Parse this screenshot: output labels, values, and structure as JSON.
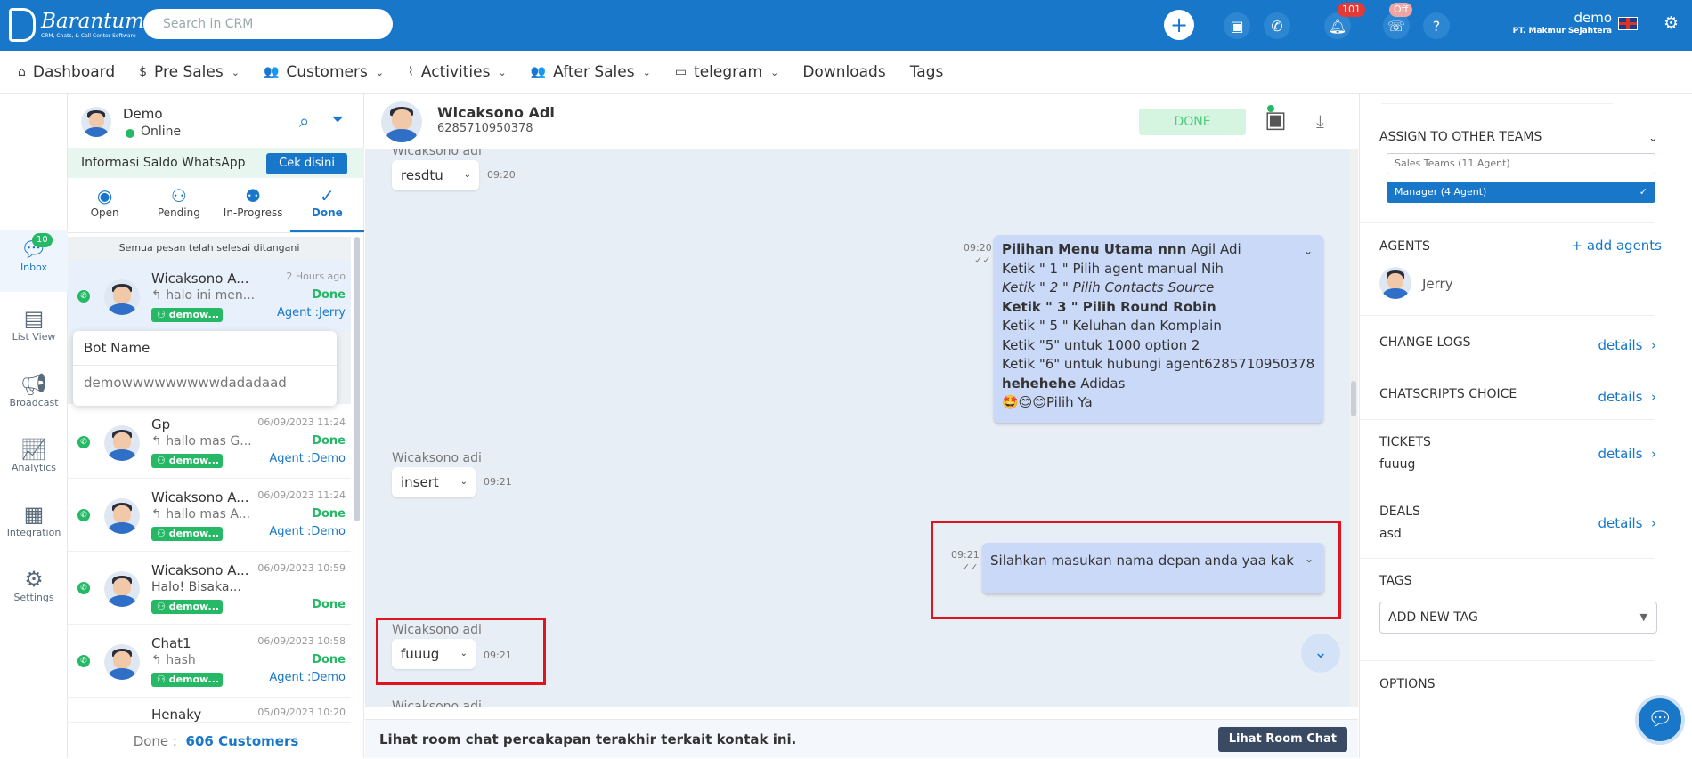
{
  "app": {
    "logo_name": "Barantum",
    "logo_tagline": "CRM, Chats, & Call Center Software",
    "search_placeholder": "Search in CRM",
    "notif_count": "101",
    "phone_status": "Off",
    "user_name": "demo",
    "company": "PT. Makmur Sejahtera"
  },
  "nav": {
    "items": [
      {
        "label": "Dashboard",
        "icon": "⌂",
        "dropdown": ""
      },
      {
        "label": "Pre Sales",
        "icon": "$",
        "dropdown": "⌄"
      },
      {
        "label": "Customers",
        "icon": "👥",
        "dropdown": "⌄"
      },
      {
        "label": "Activities",
        "icon": "⌇",
        "dropdown": "⌄"
      },
      {
        "label": "After Sales",
        "icon": "👥",
        "dropdown": "⌄"
      },
      {
        "label": "telegram",
        "icon": "▭",
        "dropdown": "⌄"
      },
      {
        "label": "Downloads",
        "icon": "",
        "dropdown": ""
      },
      {
        "label": "Tags",
        "icon": "",
        "dropdown": ""
      }
    ]
  },
  "rail": {
    "inbox_badge": "10",
    "items": [
      "Inbox",
      "List View",
      "Broadcast",
      "Analytics",
      "Integration",
      "Settings"
    ]
  },
  "chatlist": {
    "agent_name": "Demo",
    "agent_status": "Online",
    "wa_info": "Informasi Saldo WhatsApp",
    "wa_button": "Cek disini",
    "tabs": [
      "Open",
      "Pending",
      "In-Progress",
      "Done"
    ],
    "notice": "Semua pesan telah selesai ditangani",
    "tooltip_title": "Bot Name",
    "tooltip_value": "demowwwwwwwwwdadadaad",
    "conversations": [
      {
        "name": "Wicaksono A...",
        "preview": "halo ini men...",
        "time": "2 Hours ago",
        "status": "Done",
        "agent": "Agent :Jerry",
        "bot": "demow..."
      },
      {
        "name": "Gp",
        "preview": "hallo mas G...",
        "time": "06/09/2023 11:24",
        "status": "Done",
        "agent": "Agent :Demo",
        "bot": "demow..."
      },
      {
        "name": "Wicaksono A...",
        "preview": "hallo mas A...",
        "time": "06/09/2023 11:24",
        "status": "Done",
        "agent": "Agent :Demo",
        "bot": "demow..."
      },
      {
        "name": "Wicaksono A...",
        "preview": "Halo! Bisaka...",
        "time": "06/09/2023 10:59",
        "status": "Done",
        "agent": "",
        "bot": "demow..."
      },
      {
        "name": "Chat1",
        "preview": "hash",
        "time": "06/09/2023 10:58",
        "status": "Done",
        "agent": "Agent :Demo",
        "bot": "demow..."
      },
      {
        "name": "Henaky",
        "preview": "",
        "time": "05/09/2023 10:20",
        "status": "",
        "agent": "",
        "bot": ""
      }
    ],
    "footer_label": "Done :",
    "footer_count": "606 Customers"
  },
  "chat": {
    "contact_name": "Wicaksono Adi",
    "contact_phone": "6285710950378",
    "done_label": "DONE",
    "messages": {
      "m1_sender": "Wicaksono adi",
      "m1_text": "resdtu",
      "m1_time": "09:20",
      "m2_time": "09:20",
      "m2_lines": {
        "l1_bold": "Pilihan Menu Utama nnn",
        "l1_rest": " Agil Adi",
        "l2": "Ketik \" 1 \" Pilih agent manual Nih",
        "l3": "Ketik \" 2 \" Pilih Contacts Source",
        "l4": "Ketik \" 3 \" Pilih Round Robin",
        "l5": "Ketik \" 5 \" Keluhan dan Komplain",
        "l6": "Ketik \"5\" untuk 1000 option 2",
        "l7": "Ketik \"6\" untuk hubungi agent6285710950378",
        "l8_bold": "hehehehe",
        "l8_rest": " Adidas",
        "l9": "🤩😊😊Pilih Ya"
      },
      "m3_sender": "Wicaksono adi",
      "m3_text": "insert",
      "m3_time": "09:21",
      "m4_time": "09:21",
      "m4_text": "Silahkan masukan nama depan anda yaa kak",
      "m5_sender": "Wicaksono adi",
      "m5_text": "fuuug",
      "m5_time": "09:21",
      "m6_sender": "Wicaksono adi"
    },
    "footer_text": "Lihat room chat percakapan terakhir terkait kontak ini.",
    "footer_button": "Lihat Room Chat"
  },
  "panel": {
    "assign_title": "ASSIGN TO OTHER TEAMS",
    "team1": "Sales Teams (11 Agent)",
    "team2": "Manager (4 Agent)",
    "agents_title": "AGENTS",
    "add_agents": "+ add agents",
    "agent1": "Jerry",
    "change_logs": "CHANGE LOGS",
    "chatscripts": "CHATSCRIPTS CHOICE",
    "tickets": "TICKETS",
    "tickets_value": "fuuug",
    "deals": "DEALS",
    "deals_value": "asd",
    "details": "details",
    "tags_title": "TAGS",
    "tags_select": "ADD NEW TAG",
    "options": "OPTIONS"
  }
}
